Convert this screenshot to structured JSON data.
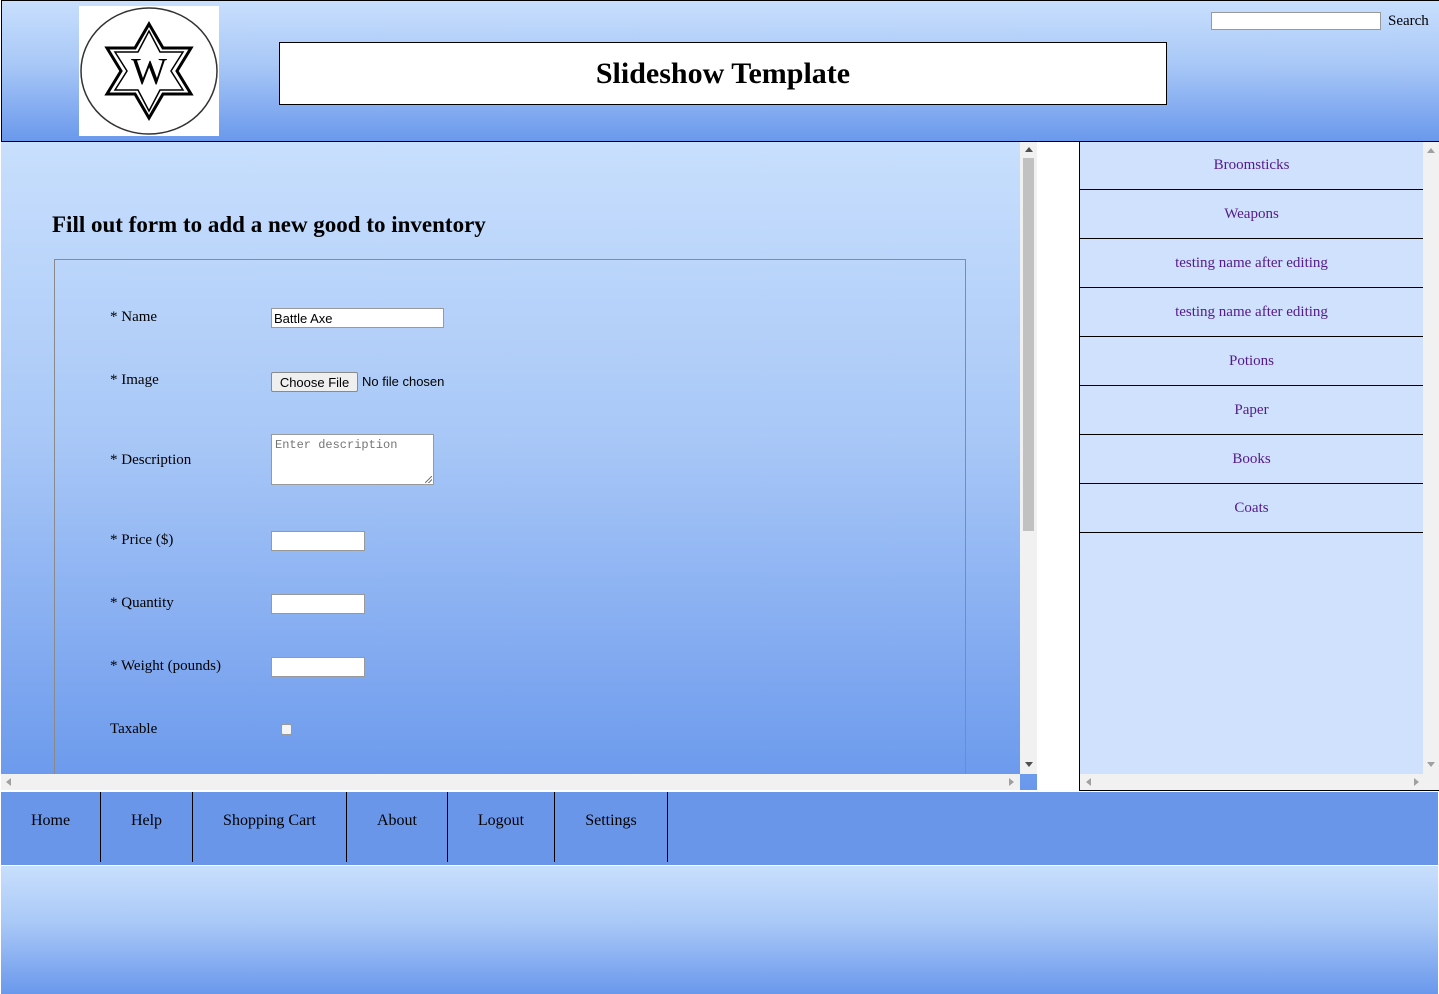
{
  "header": {
    "title": "Slideshow Template",
    "logo_letter": "W",
    "search_label": "Search",
    "search_value": ""
  },
  "form": {
    "heading": "Fill out form to add a new good to inventory",
    "name_label": "* Name",
    "name_value": "Battle Axe",
    "image_label": "* Image",
    "choose_file_label": "Choose File",
    "file_status": "No file chosen",
    "description_label": "* Description",
    "description_placeholder": "Enter description",
    "price_label": "* Price ($)",
    "quantity_label": "* Quantity",
    "weight_label": "* Weight (pounds)",
    "taxable_label": "Taxable",
    "taxable_checked": false
  },
  "sidebar": {
    "items": [
      {
        "label": "Broomsticks"
      },
      {
        "label": "Weapons"
      },
      {
        "label": "testing name after editing"
      },
      {
        "label": "testing name after editing"
      },
      {
        "label": "Potions"
      },
      {
        "label": "Paper"
      },
      {
        "label": "Books"
      },
      {
        "label": "Coats"
      }
    ]
  },
  "nav": {
    "items": [
      {
        "label": "Home"
      },
      {
        "label": "Help"
      },
      {
        "label": "Shopping Cart"
      },
      {
        "label": "About"
      },
      {
        "label": "Logout"
      },
      {
        "label": "Settings"
      }
    ]
  },
  "colors": {
    "gradient_top": "#c8dffd",
    "gradient_bottom": "#6a98ec",
    "nav_bg": "#6a96ea",
    "sidebar_bg": "#cfe1fd",
    "link_color": "#551a8b"
  }
}
